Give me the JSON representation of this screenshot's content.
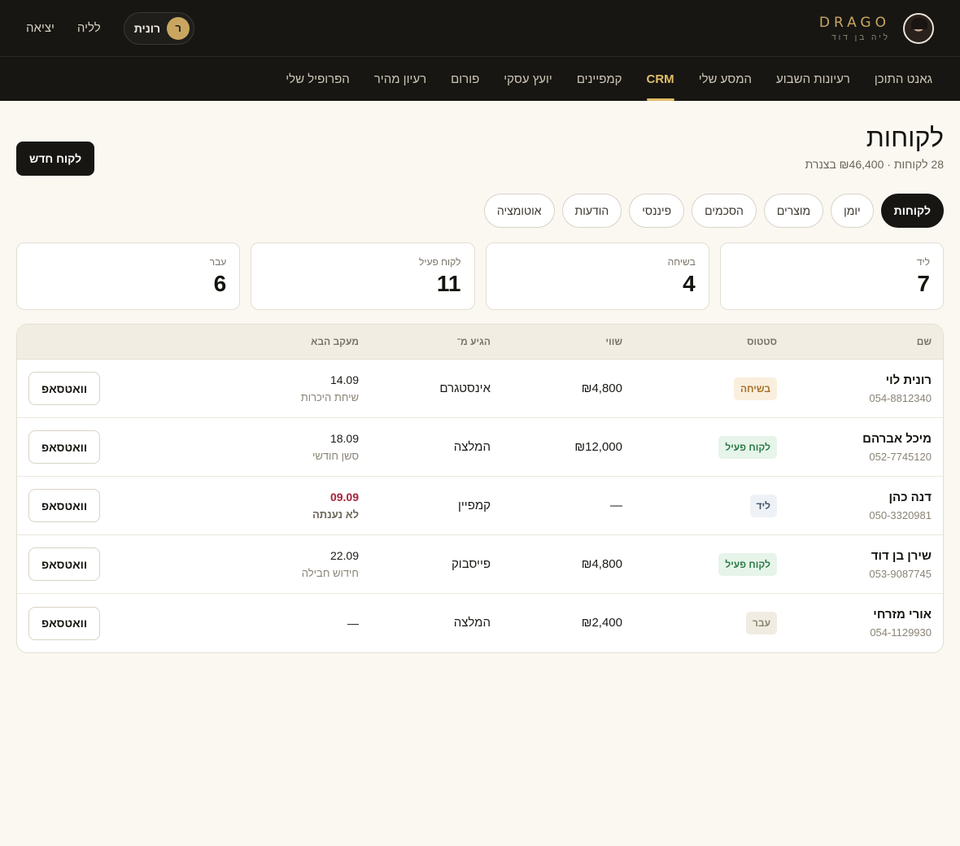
{
  "brand": {
    "name": "DRAGO",
    "subtitle": "ליה בן דוד"
  },
  "user": {
    "initial": "ר",
    "name": "רונית"
  },
  "top_links": {
    "night": "לליה",
    "logout": "יציאה"
  },
  "nav": [
    "גאנט התוכן",
    "רעיונות השבוע",
    "המסע שלי",
    "CRM",
    "קמפיינים",
    "יועץ עסקי",
    "פורום",
    "רעיון מהיר",
    "הפרופיל שלי"
  ],
  "nav_active": "CRM",
  "page": {
    "title": "לקוחות",
    "subtitle": "28 לקוחות · ₪46,400 בצנרת",
    "new_button": "לקוח חדש"
  },
  "tabs": [
    "לקוחות",
    "יומן",
    "מוצרים",
    "הסכמים",
    "פיננסי",
    "הודעות",
    "אוטומציה"
  ],
  "tab_active": "לקוחות",
  "stats": [
    {
      "label": "ליד",
      "value": "7"
    },
    {
      "label": "בשיחה",
      "value": "4"
    },
    {
      "label": "לקוח פעיל",
      "value": "11"
    },
    {
      "label": "עבר",
      "value": "6"
    }
  ],
  "table": {
    "headers": {
      "name": "שם",
      "status": "סטטוס",
      "value": "שווי",
      "source": "הגיע מ־",
      "next": "מעקב הבא"
    },
    "rows": [
      {
        "name": "רונית לוי",
        "phone": "054-8812340",
        "status": "בשיחה",
        "status_kind": "talk",
        "value": "₪4,800",
        "source": "אינסטגרם",
        "next_date": "14.09",
        "next_note": "שיחת היכרות",
        "overdue": false,
        "action": "וואטסאפ"
      },
      {
        "name": "מיכל אברהם",
        "phone": "052-7745120",
        "status": "לקוח פעיל",
        "status_kind": "active",
        "value": "₪12,000",
        "source": "המלצה",
        "next_date": "18.09",
        "next_note": "סשן חודשי",
        "overdue": false,
        "action": "וואטסאפ"
      },
      {
        "name": "דנה כהן",
        "phone": "050-3320981",
        "status": "ליד",
        "status_kind": "lead",
        "value": "—",
        "source": "קמפיין",
        "next_date": "09.09",
        "next_note": "לא נענתה",
        "overdue": true,
        "action": "וואטסאפ"
      },
      {
        "name": "שירן בן דוד",
        "phone": "053-9087745",
        "status": "לקוח פעיל",
        "status_kind": "active",
        "value": "₪4,800",
        "source": "פייסבוק",
        "next_date": "22.09",
        "next_note": "חידוש חבילה",
        "overdue": false,
        "action": "וואטסאפ"
      },
      {
        "name": "אורי מזרחי",
        "phone": "054-1129930",
        "status": "עבר",
        "status_kind": "past",
        "value": "₪2,400",
        "source": "המלצה",
        "next_date": "—",
        "next_note": "",
        "overdue": false,
        "action": "וואטסאפ"
      }
    ]
  },
  "colors": {
    "accent": "#e1bd6a",
    "dark": "#171613",
    "background": "#fbf8f2",
    "overdue": "#a3233a"
  }
}
